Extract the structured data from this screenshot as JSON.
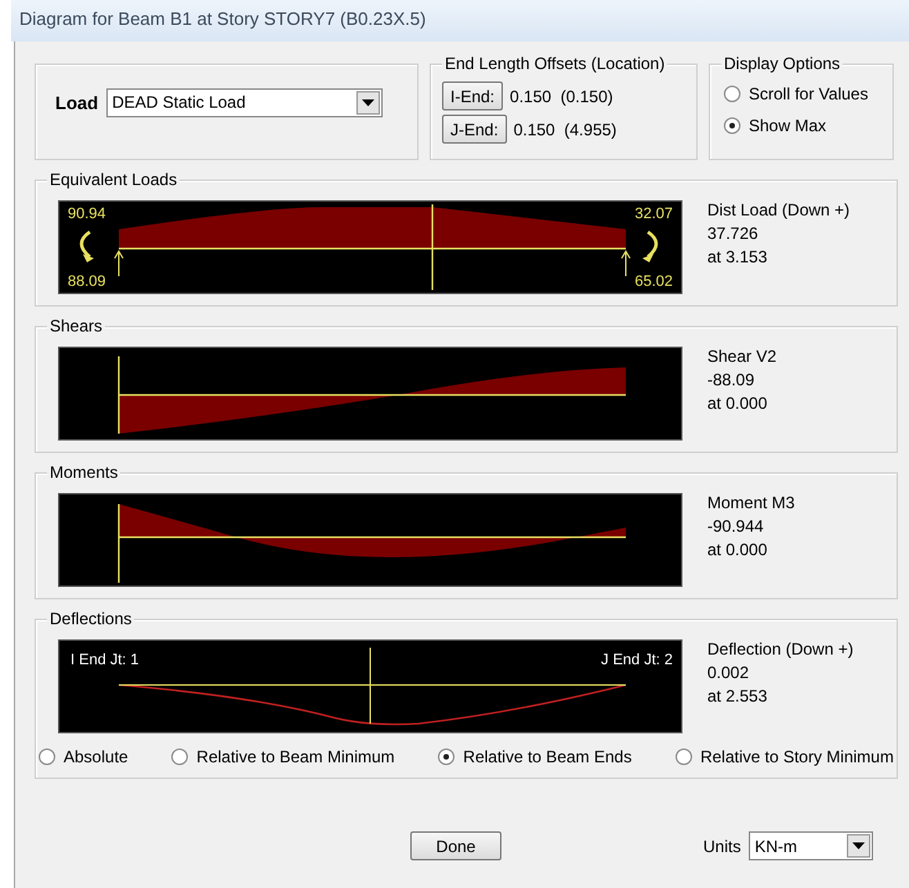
{
  "window": {
    "title": "Diagram for Beam B1 at Story STORY7 (B0.23X.5)"
  },
  "load": {
    "label": "Load",
    "value": "DEAD Static Load"
  },
  "end_offsets": {
    "title": "End Length Offsets (Location)",
    "rows": [
      {
        "button": "I-End:",
        "value": "0.150  (0.150)"
      },
      {
        "button": "J-End:",
        "value": "0.150  (4.955)"
      }
    ]
  },
  "display_options": {
    "title": "Display Options",
    "options": [
      {
        "label": "Scroll for Values",
        "selected": false
      },
      {
        "label": "Show Max",
        "selected": true
      }
    ]
  },
  "panels": [
    {
      "kind": "loads",
      "title": "Equivalent Loads",
      "labels": [
        "90.94",
        "88.09",
        "32.07",
        "65.02"
      ],
      "readout": [
        "Dist Load (Down +)",
        "37.726",
        "at 3.153"
      ]
    },
    {
      "kind": "shear",
      "title": "Shears",
      "readout": [
        "Shear V2",
        "-88.09",
        "at 0.000"
      ]
    },
    {
      "kind": "moment",
      "title": "Moments",
      "readout": [
        "Moment M3",
        "-90.944",
        "at 0.000"
      ]
    },
    {
      "kind": "deflection",
      "title": "Deflections",
      "labels": [
        "I End Jt: 1",
        "J End Jt: 2"
      ],
      "readout": [
        "Deflection (Down +)",
        "0.002",
        "at 2.553"
      ],
      "options": [
        {
          "label": "Absolute",
          "selected": false
        },
        {
          "label": "Relative to Beam Minimum",
          "selected": false
        },
        {
          "label": "Relative to Beam Ends",
          "selected": true
        },
        {
          "label": "Relative to Story Minimum",
          "selected": false
        }
      ]
    }
  ],
  "done_button": "Done",
  "units": {
    "label": "Units",
    "value": "KN-m"
  }
}
